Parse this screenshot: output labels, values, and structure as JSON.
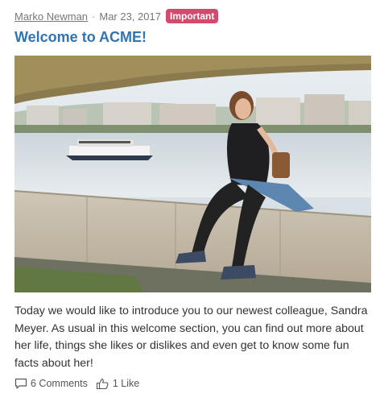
{
  "post": {
    "author": "Marko Newman",
    "separator": "·",
    "date": "Mar 23, 2017",
    "badge": "Important",
    "title": "Welcome to ACME!",
    "body": "Today we would like to introduce you to our newest colleague, Sandra Meyer. As usual in this welcome section, you can find out more about her life, things she likes or dislikes and even get to know some fun facts about her!",
    "comments_label": "6 Comments",
    "likes_label": "1 Like"
  },
  "icons": {
    "comments": "comment-icon",
    "likes": "thumbs-up-icon"
  },
  "colors": {
    "badge": "#d44a6f",
    "title": "#2f74b5"
  }
}
